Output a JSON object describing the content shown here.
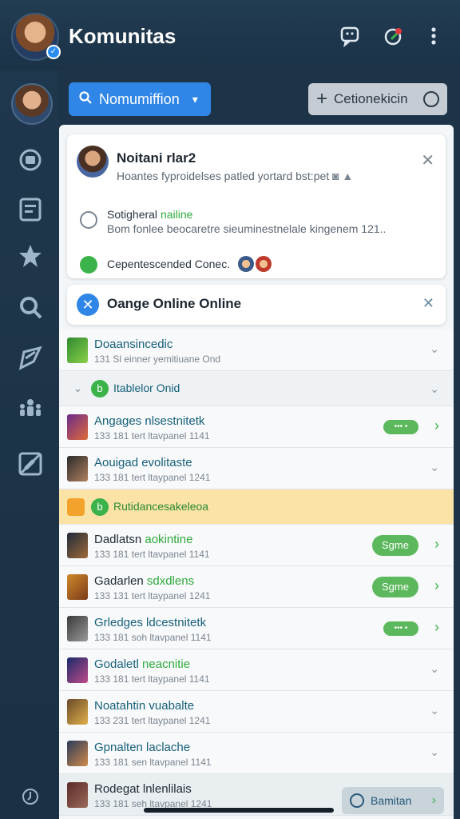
{
  "app": {
    "title": "Komunitas"
  },
  "toolbar": {
    "filter_label": "Nomumiffion",
    "connect_label": "Cetionekicin"
  },
  "card_notice": {
    "title": "Noitani rlar2",
    "subtitle": "Hoantes fyproidelses patled yortard bst:pet",
    "row2_title_a": "Sotigheral ",
    "row2_title_b": "nailine",
    "row2_sub": "Bom fonlee beocaretre sieuminestnelale kingenem 121..",
    "row3_text": "Cepentescended Conec."
  },
  "card_online": {
    "title": "Oange Online Online"
  },
  "list": {
    "row1": {
      "name": "Doaansincedic",
      "meta": "131 Sl einner yemitiuane Ond"
    },
    "section1": {
      "label": "Itablelor Onid"
    },
    "row2": {
      "name": "Angages nlsestnitetk",
      "meta": "133 181 tert ltavpanel 1141",
      "pill": "••• •"
    },
    "row3": {
      "name": "Aouigad evolitaste",
      "meta": "133 181 tert ltaypanel 1241"
    },
    "section2": {
      "label": "Rutidancesakeleoa"
    },
    "row4": {
      "name_a": "Dadlatsn ",
      "name_b": "aokintine",
      "meta": "133 181 tert ltavpanel 1141",
      "pill": "Sgme"
    },
    "row5": {
      "name_a": "Gadarlen ",
      "name_b": "sdxdlens",
      "meta": "133 131 tert ltaypanel 1241",
      "pill": "Sgme"
    },
    "row6": {
      "name": "Grledges ldcestnitetk",
      "meta": "133 181 soh ltavpanel 1141",
      "pill": "••• •"
    },
    "row7": {
      "name_a": "Godaletl ",
      "name_b": "neacnitie",
      "meta": "133 181 tert ltaypanel 1141"
    },
    "row8": {
      "name": "Noatahtin vuabalte",
      "meta": "133 231 tert ltaypanel 1241"
    },
    "row9": {
      "name": "Gpnalten laclache",
      "meta": "133 181 sen ltavpanel 1141"
    },
    "row10": {
      "name": "Rodegat lnlenlilais",
      "meta": "133 181 seh ltavpanel 1241"
    }
  },
  "bottom_button": {
    "label": "Bamitan"
  },
  "colors": {
    "accent": "#2f86e6",
    "green": "#3bb34a",
    "sidebar": "#1f374c",
    "highlight": "#fbe3a6"
  }
}
